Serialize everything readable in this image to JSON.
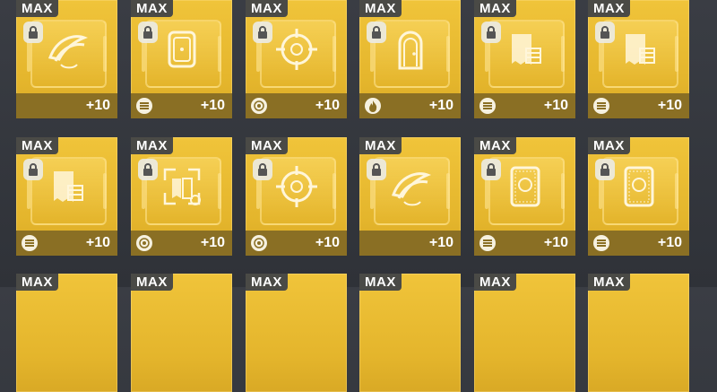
{
  "colors": {
    "card": "#e8b830",
    "footer": "#8a6f24",
    "badge": "#4a4a46",
    "background": "#32353b"
  },
  "cards": [
    {
      "badge": "MAX",
      "emblem": "feather-swoop-icon",
      "stat": "lines-icon-none",
      "level": "+10"
    },
    {
      "badge": "MAX",
      "emblem": "door-frame-icon",
      "stat": "bars-icon",
      "level": "+10"
    },
    {
      "badge": "MAX",
      "emblem": "crosshair-icon",
      "stat": "target-icon",
      "level": "+10"
    },
    {
      "badge": "MAX",
      "emblem": "arched-door-icon",
      "stat": "flame-icon",
      "level": "+10"
    },
    {
      "badge": "MAX",
      "emblem": "document-stack-icon",
      "stat": "bars-icon",
      "level": "+10"
    },
    {
      "badge": "MAX",
      "emblem": "document-stack-icon",
      "stat": "bars-icon",
      "level": "+10"
    },
    {
      "badge": "MAX",
      "emblem": "document-stack-icon",
      "stat": "bars-icon",
      "level": "+10"
    },
    {
      "badge": "MAX",
      "emblem": "reticle-book-icon",
      "stat": "target-icon",
      "level": "+10"
    },
    {
      "badge": "MAX",
      "emblem": "crosshair-icon",
      "stat": "target-icon",
      "level": "+10"
    },
    {
      "badge": "MAX",
      "emblem": "feather-swoop-icon",
      "stat": "none",
      "level": "+10"
    },
    {
      "badge": "MAX",
      "emblem": "ornate-panel-icon",
      "stat": "bars-icon",
      "level": "+10"
    },
    {
      "badge": "MAX",
      "emblem": "ornate-panel-icon",
      "stat": "bars-icon",
      "level": "+10"
    },
    {
      "badge": "MAX"
    },
    {
      "badge": "MAX"
    },
    {
      "badge": "MAX"
    },
    {
      "badge": "MAX"
    },
    {
      "badge": "MAX"
    },
    {
      "badge": "MAX"
    }
  ]
}
